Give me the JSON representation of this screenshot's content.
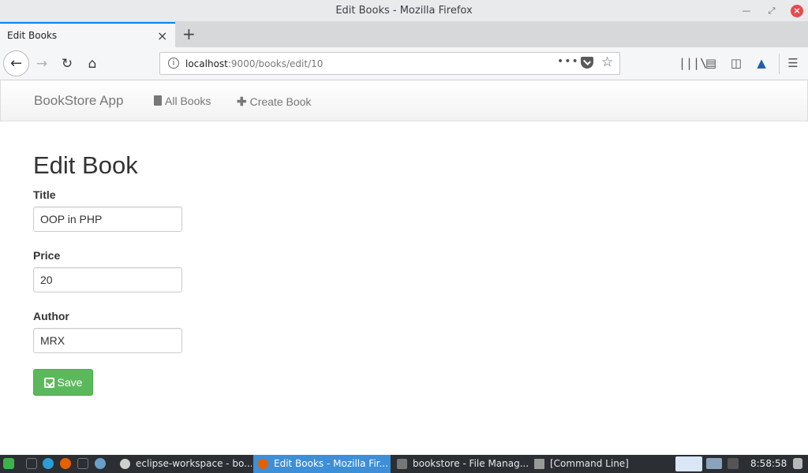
{
  "window": {
    "title": "Edit Books - Mozilla Firefox"
  },
  "browser": {
    "tab_label": "Edit Books",
    "url_host": "localhost",
    "url_path": ":9000/books/edit/10"
  },
  "app_nav": {
    "brand": "BookStore App",
    "links": [
      {
        "label": "All Books",
        "icon": "book-icon"
      },
      {
        "label": "Create Book",
        "icon": "plus-icon"
      }
    ]
  },
  "form": {
    "heading": "Edit Book",
    "fields": [
      {
        "label": "Title",
        "value": "OOP in PHP"
      },
      {
        "label": "Price",
        "value": "20"
      },
      {
        "label": "Author",
        "value": "MRX"
      }
    ],
    "submit_label": "Save"
  },
  "taskbar": {
    "tasks": [
      {
        "label": "eclipse-workspace - bo..."
      },
      {
        "label": "Edit Books - Mozilla Fir..."
      },
      {
        "label": "bookstore - File Manag..."
      },
      {
        "label": "[Command Line]"
      }
    ],
    "clock": "8:58:58"
  },
  "colors": {
    "accent": "#0a84ff",
    "success": "#5cb85c",
    "taskbar_active": "#3d8fd8"
  }
}
